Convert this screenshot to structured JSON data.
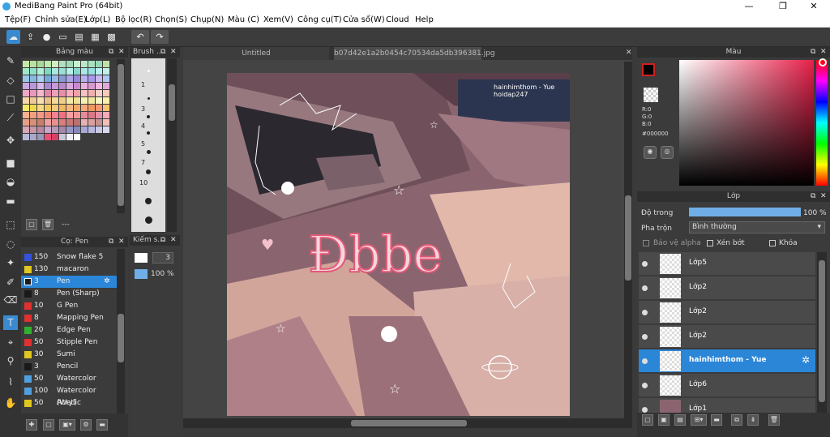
{
  "window": {
    "title": "MediBang Paint Pro (64bit)",
    "min": "—",
    "max": "❐",
    "close": "✕"
  },
  "menu": [
    "Tệp(F)",
    "Chỉnh sửa(E)",
    "Lớp(L)",
    "Bộ lọc(R)",
    "Chọn(S)",
    "Chụp(N)",
    "Màu (C)",
    "Xem(V)",
    "Công cụ(T)",
    "Cửa sổ(W)",
    "Cloud",
    "Help"
  ],
  "palette": {
    "title": "Bảng màu"
  },
  "brush_size": {
    "title": "Brush ...",
    "sizes": [
      "1",
      "3",
      "4",
      "5",
      "7",
      "10"
    ]
  },
  "brush_list": {
    "title": "Cọ: Pen",
    "items": [
      {
        "n": "150",
        "l": "Snow flake 5",
        "c": "#3352e0"
      },
      {
        "n": "130",
        "l": "macaron",
        "c": "#e0c820"
      },
      {
        "n": "3",
        "l": "Pen",
        "c": "#1a1a1a",
        "sel": true
      },
      {
        "n": "8",
        "l": "Pen (Sharp)",
        "c": "#1a1a1a"
      },
      {
        "n": "10",
        "l": "G Pen",
        "c": "#e03030"
      },
      {
        "n": "8",
        "l": "Mapping Pen",
        "c": "#e03030"
      },
      {
        "n": "20",
        "l": "Edge Pen",
        "c": "#30b030"
      },
      {
        "n": "50",
        "l": "Stipple Pen",
        "c": "#e03030"
      },
      {
        "n": "30",
        "l": "Sumi",
        "c": "#e0c820"
      },
      {
        "n": "3",
        "l": "Pencil",
        "c": "#1a1a1a"
      },
      {
        "n": "50",
        "l": "Watercolor",
        "c": "#50a0e0"
      },
      {
        "n": "100",
        "l": "Watercolor (Wet)",
        "c": "#50a0e0"
      },
      {
        "n": "50",
        "l": "Acrylic",
        "c": "#e0c820"
      }
    ],
    "dashes": "---"
  },
  "brush_props": {
    "title": "Kiếm s...",
    "size": "3",
    "opacity": "100 %"
  },
  "tabs": {
    "left": "Untitled",
    "right": "b07d42e1a2b0454c70534da5db396381.jpg"
  },
  "canvas": {
    "watermark_line1": "hainhimthom - Yue",
    "watermark_line2": "hoidap247"
  },
  "color": {
    "title": "Màu",
    "r": "R:0",
    "g": "G:0",
    "b": "B:0",
    "hex": "#000000",
    "colors": {
      "fg": "#000000",
      "accent": "#cc2222"
    }
  },
  "layers": {
    "title": "Lớp",
    "opacity_label": "Độ trong",
    "opacity_value": "100 %",
    "blend_label": "Pha trộn",
    "blend_value": "Bình thường",
    "protect_alpha": "Bảo vệ alpha",
    "clip": "Xén bớt",
    "lock": "Khóa",
    "items": [
      {
        "name": "Lớp5"
      },
      {
        "name": "Lớp2"
      },
      {
        "name": "Lớp2"
      },
      {
        "name": "Lớp2"
      },
      {
        "name": "hainhimthom - Yue",
        "sel": true
      },
      {
        "name": "Lớp6"
      },
      {
        "name": "Lớp1"
      }
    ]
  }
}
